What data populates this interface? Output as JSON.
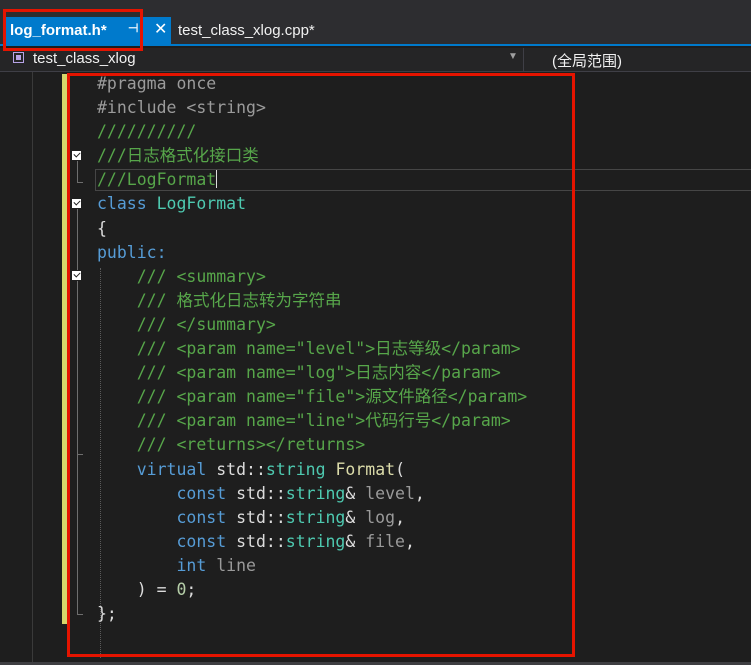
{
  "tabs": [
    {
      "label": "log_format.h*",
      "active": true,
      "pin_glyph": "⊣",
      "close_glyph": "✕"
    },
    {
      "label": "test_class_xlog.cpp*",
      "active": false
    }
  ],
  "nav": {
    "scope_left": "test_class_xlog",
    "scope_right": "(全局范围)"
  },
  "code_lines": [
    "#pragma once",
    "#include <string>",
    "//////////",
    "///日志格式化接口类",
    "///LogFormat",
    "class LogFormat",
    "{",
    "public:",
    "    /// <summary>",
    "    /// 格式化日志转为字符串",
    "    /// </summary>",
    "    /// <param name=\"level\">日志等级</param>",
    "    /// <param name=\"log\">日志内容</param>",
    "    /// <param name=\"file\">源文件路径</param>",
    "    /// <param name=\"line\">代码行号</param>",
    "    /// <returns></returns>",
    "    virtual std::string Format(",
    "        const std::string& level,",
    "        const std::string& log,",
    "        const std::string& file,",
    "        int line",
    "    ) = 0;",
    "};"
  ],
  "colors": {
    "accent": "#007acc",
    "highlight_box": "#e51400",
    "keyword": "#569cd6",
    "comment": "#57a64a",
    "type": "#4ec9b0",
    "string": "#d69d85"
  }
}
